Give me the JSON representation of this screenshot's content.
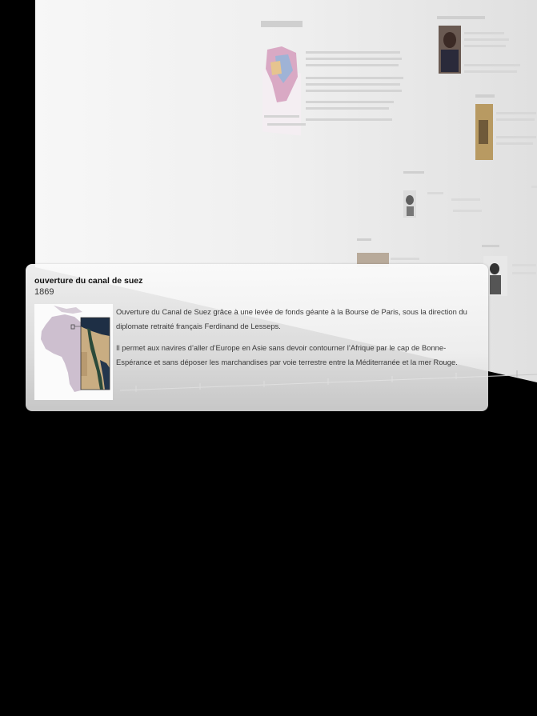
{
  "event": {
    "title": "ouverture du canal de suez",
    "year": "1869",
    "paragraphs": [
      "Ouverture du Canal de Suez grâce à une levée de fonds géante à la Bourse de Paris, sous la direction du diplomate retraité français Ferdinand de Lesseps.",
      "Il permet aux navires d’aller d’Europe en Asie sans devoir contourner l’Afrique par le cap de Bonne-Espérance et sans déposer les marchandises par voie terrestre entre la Méditerranée et la mer Rouge."
    ],
    "thumbnail_icon": "africa-suez-map-icon"
  },
  "colors": {
    "background": "#000000",
    "card_top": "#fafafa",
    "card_bottom": "#d6d6d6",
    "text": "#3a3a3a",
    "title": "#111111",
    "map_land": "#cdbfcf",
    "satellite_desert": "#c9ad82",
    "satellite_water": "#1e2f45"
  }
}
